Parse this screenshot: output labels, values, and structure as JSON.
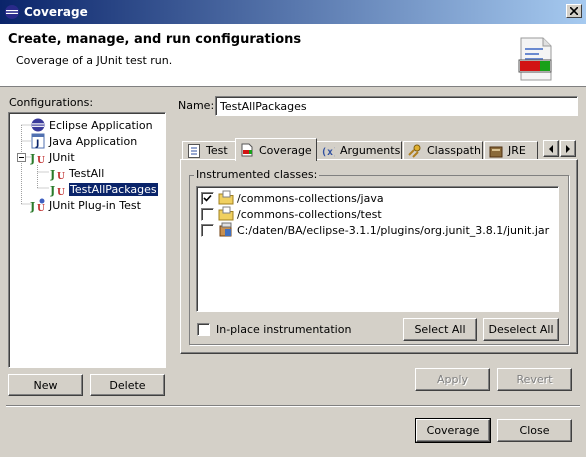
{
  "window": {
    "title": "Coverage"
  },
  "header": {
    "title": "Create, manage, and run configurations",
    "subtitle": "Coverage of a JUnit test run."
  },
  "configurations": {
    "label": "Configurations:",
    "items": [
      {
        "label": "Eclipse Application",
        "icon": "eclipse-icon"
      },
      {
        "label": "Java Application",
        "icon": "java-app-icon"
      },
      {
        "label": "JUnit",
        "icon": "junit-icon",
        "expanded": true
      },
      {
        "label": "TestAll",
        "icon": "junit-icon"
      },
      {
        "label": "TestAllPackages",
        "icon": "junit-icon",
        "selected": true
      },
      {
        "label": "JUnit Plug-in Test",
        "icon": "junit-plugin-icon"
      }
    ],
    "new_label": "New",
    "delete_label": "Delete"
  },
  "name_field": {
    "label": "Name:",
    "value": "TestAllPackages"
  },
  "tabs": [
    {
      "label": "Test",
      "icon": "test-icon"
    },
    {
      "label": "Coverage",
      "icon": "coverage-icon",
      "active": true
    },
    {
      "label": "Arguments",
      "icon": "arguments-icon"
    },
    {
      "label": "Classpath",
      "icon": "classpath-icon"
    },
    {
      "label": "JRE",
      "icon": "jre-icon"
    }
  ],
  "coverage": {
    "group_label": "Instrumented classes:",
    "classes": [
      {
        "path": "/commons-collections/java",
        "checked": true,
        "icon": "folder-icon"
      },
      {
        "path": "/commons-collections/test",
        "checked": false,
        "icon": "folder-icon"
      },
      {
        "path": "C:/daten/BA/eclipse-3.1.1/plugins/org.junit_3.8.1/junit.jar",
        "checked": false,
        "icon": "jar-icon"
      }
    ],
    "inplace_label": "In-place instrumentation",
    "inplace_checked": false,
    "select_all_label": "Select All",
    "deselect_all_label": "Deselect All"
  },
  "actions": {
    "apply_label": "Apply",
    "revert_label": "Revert",
    "coverage_label": "Coverage",
    "close_label": "Close"
  }
}
